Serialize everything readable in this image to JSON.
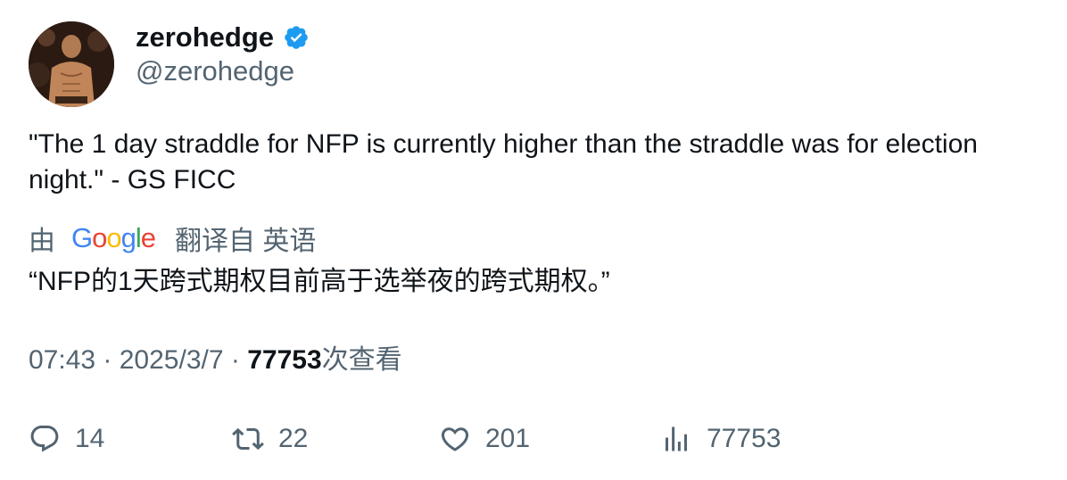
{
  "author": {
    "display_name": "zerohedge",
    "handle": "@zerohedge",
    "verified_icon": "verified-badge-icon",
    "verified_color": "#1d9bf0"
  },
  "tweet": {
    "text": "\"The 1 day straddle for NFP is currently higher than the straddle was for election night.\" - GS FICC"
  },
  "translation": {
    "by_label": "由",
    "provider": "Google",
    "from_label": "翻译自 英语",
    "text": "“NFP的1天跨式期权目前高于选举夜的跨式期权。”"
  },
  "meta": {
    "time": "07:43",
    "date": "2025/3/7",
    "views": "77753",
    "views_suffix": "次查看"
  },
  "actions": {
    "replies": "14",
    "retweets": "22",
    "likes": "201",
    "views": "77753"
  },
  "colors": {
    "text": "#0f1419",
    "secondary": "#536471",
    "google_blue": "#4285f4",
    "google_red": "#ea4335",
    "google_yellow": "#fbbc05",
    "google_green": "#34a853"
  }
}
